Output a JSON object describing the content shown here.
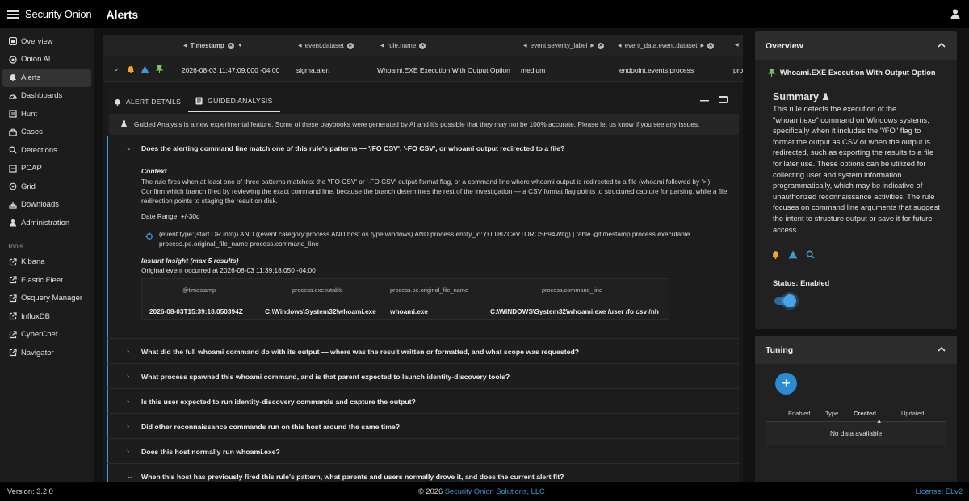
{
  "app": {
    "logo": "Security Onion",
    "page_title": "Alerts"
  },
  "sidebar": {
    "items": [
      {
        "label": "Overview",
        "icon": "overview-icon"
      },
      {
        "label": "Onion AI",
        "icon": "onion-ai-icon"
      },
      {
        "label": "Alerts",
        "icon": "bell-icon"
      },
      {
        "label": "Dashboards",
        "icon": "dashboard-icon"
      },
      {
        "label": "Hunt",
        "icon": "hunt-icon"
      },
      {
        "label": "Cases",
        "icon": "briefcase-icon"
      },
      {
        "label": "Detections",
        "icon": "search-icon"
      },
      {
        "label": "PCAP",
        "icon": "pcap-icon"
      },
      {
        "label": "Grid",
        "icon": "grid-icon"
      },
      {
        "label": "Downloads",
        "icon": "download-icon"
      },
      {
        "label": "Administration",
        "icon": "admin-icon"
      }
    ],
    "tools_label": "Tools",
    "tools": [
      {
        "label": "Kibana"
      },
      {
        "label": "Elastic Fleet"
      },
      {
        "label": "Osquery Manager"
      },
      {
        "label": "InfluxDB"
      },
      {
        "label": "CyberChef"
      },
      {
        "label": "Navigator"
      }
    ]
  },
  "columns": [
    "Timestamp",
    "event.dataset",
    "rule.name",
    "event.severity_label",
    "event_data.event.dataset",
    "pro"
  ],
  "alert": {
    "timestamp": "2026-08-03 11:47:09.000 -04:00",
    "dataset": "sigma.alert",
    "rule_name": "Whoami.EXE Execution With Output Option",
    "severity": "medium",
    "event_dataset": "endpoint.events.process",
    "extra": "pro"
  },
  "tabs": {
    "details": "ALERT DETAILS",
    "guided": "GUIDED ANALYSIS"
  },
  "notice": "Guided Analysis is a new experimental feature. Some of these playbooks were generated by AI and it's possible that they may not be 100% accurate. Please let us know if you see any issues.",
  "question_open": {
    "title": "Does the alerting command line match one of this rule's patterns — '/FO CSV', '-FO CSV', or whoami output redirected to a file?",
    "context_label": "Context",
    "context": "The rule fires when at least one of three patterns matches: the '/FO CSV' or '-FO CSV' output-format flag, or a command line where whoami output is redirected to a file (whoami followed by '>'). Confirm which branch fired by reviewing the exact command line, because the branch determines the rest of the investigation — a CSV format flag points to structured capture for parsing, while a file redirection points to staging the result on disk.",
    "date_range": "Date Range: +/-30d",
    "query": "(event.type:(start OR info)) AND ((event.category:process AND host.os.type:windows) AND process.entity_id:YrTT8IZCeVTOROS694Wlfg) | table @timestamp process.executable process.pe.original_file_name process.command_line",
    "insight_label": "Instant Insight (max 5 results)",
    "insight_text": "Original event occurred at 2026-08-03 11:39:18.050 -04:00",
    "table_headers": [
      "@timestamp",
      "process.executable",
      "process.pe.original_file_name",
      "process.command_line"
    ],
    "table_row": [
      "2026-08-03T15:39:18.050394Z",
      "C:\\Windows\\System32\\whoami.exe",
      "whoami.exe",
      "C:\\WINDOWS\\System32\\whoami.exe /user /fo csv /nh"
    ]
  },
  "questions": [
    "What did the full whoami command do with its output — where was the result written or formatted, and what scope was requested?",
    "What process spawned this whoami command, and is that parent expected to launch identity-discovery tools?",
    "Is this user expected to run identity-discovery commands and capture the output?",
    "Did other reconnaissance commands run on this host around the same time?",
    "Does this host normally run whoami.exe?",
    "When this host has previously fired this rule's pattern, what parents and users normally drove it, and does the current alert fit?"
  ],
  "overview": {
    "title": "Overview",
    "rule_name": "Whoami.EXE Execution With Output Option",
    "summary_label": "Summary",
    "summary": "This rule detects the execution of the \"whoami.exe\" command on Windows systems, specifically when it includes the \"/FO\" flag to format the output as CSV or when the output is redirected, such as exporting the results to a file for later use. These options can be utilized for collecting user and system information programmatically, which may be indicative of unauthorized reconnaissance activities. The rule focuses on command line arguments that suggest the intent to structure output or save it for future access.",
    "status": "Status: Enabled",
    "enabled": true
  },
  "tuning": {
    "title": "Tuning",
    "headers": [
      "Enabled",
      "Type",
      "Created",
      "Updated"
    ],
    "empty": "No data available"
  },
  "footer": {
    "version": "Version: 3.2.0",
    "copyright_prefix": "© 2026",
    "copyright_link": "Security Onion Solutions, LLC",
    "license": "License:  ELv2"
  },
  "colors": {
    "accent": "#3a9bd5",
    "alert_orange": "#f5a623",
    "pin_green": "#7cc36b"
  }
}
